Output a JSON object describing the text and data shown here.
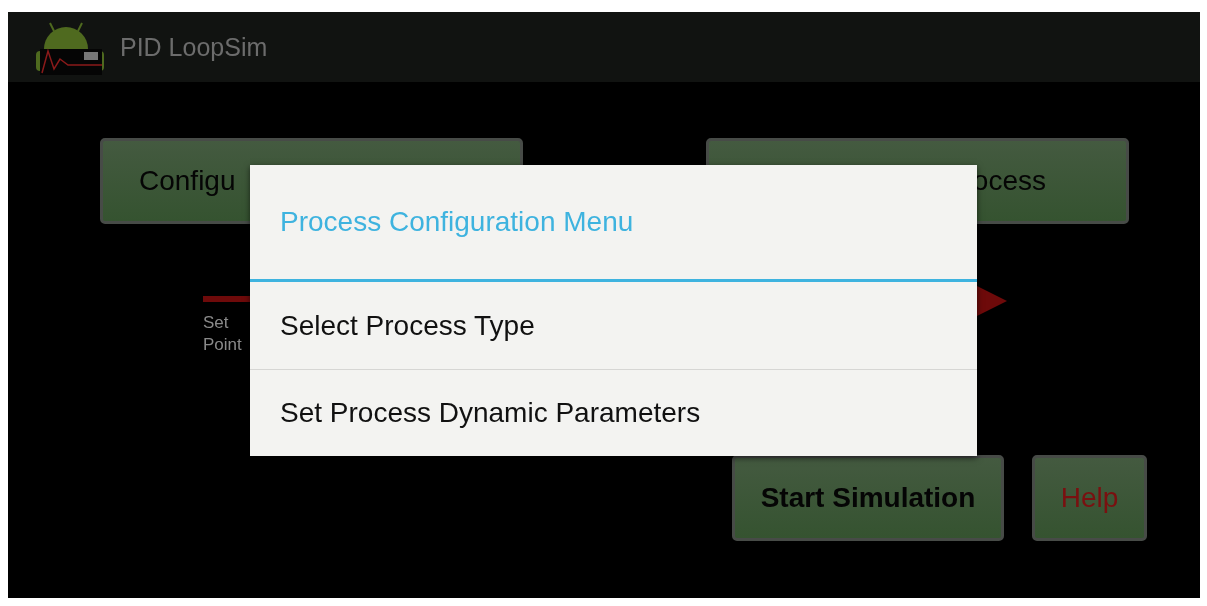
{
  "app_bar": {
    "title": "PID LoopSim"
  },
  "top_buttons": [
    {
      "label": "Configu"
    },
    {
      "label": "ocess"
    }
  ],
  "diagram": {
    "setpoint_label": "Set Point"
  },
  "dialog": {
    "title": "Process Configuration Menu",
    "items": [
      "Select Process Type",
      "Set Process Dynamic Parameters"
    ]
  },
  "bottom_buttons": [
    {
      "label": "Start Simulation",
      "kind": "primary"
    },
    {
      "label": "Help",
      "kind": "help"
    }
  ]
}
